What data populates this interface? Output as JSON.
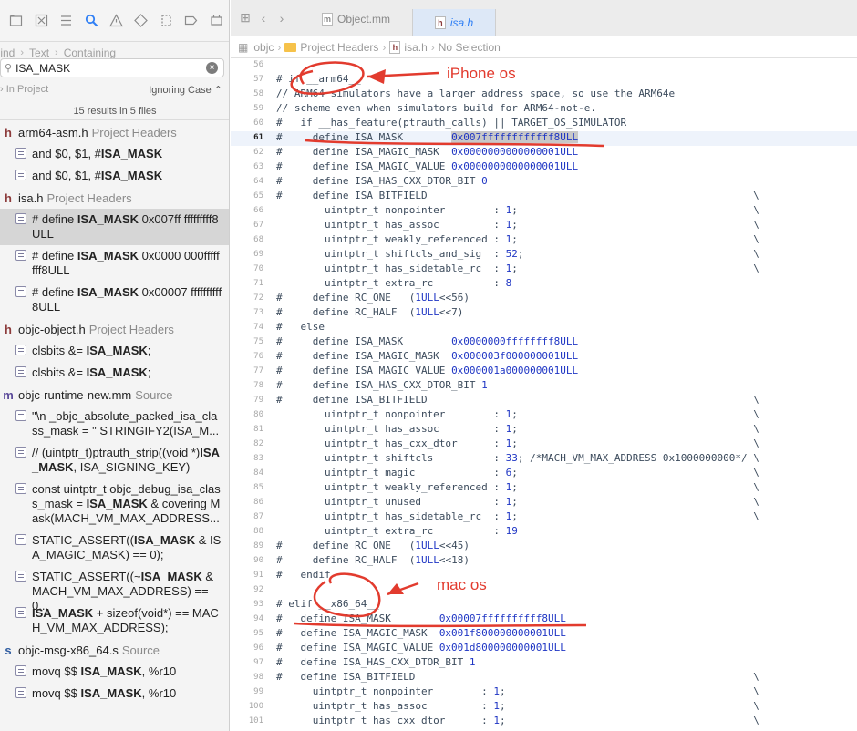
{
  "navigator": {
    "find_path": [
      "Find",
      "Text",
      "Containing"
    ],
    "search_value": "ISA_MASK",
    "scope": "In Project",
    "matching": "Ignoring Case",
    "results_summary": "15 results in 5 files",
    "groups": [
      {
        "type": "h",
        "file": "arm64-asm.h",
        "group": "Project Headers",
        "results": [
          {
            "text": "and  $0, $1, #ISA_MASK",
            "lines": 1
          },
          {
            "text": "and    $0, $1, #ISA_MASK",
            "lines": 1
          }
        ]
      },
      {
        "type": "h",
        "file": "isa.h",
        "group": "Project Headers",
        "results": [
          {
            "text": "#    define ISA_MASK          0x007ff fffffffff8ULL",
            "lines": 2,
            "selected": true
          },
          {
            "text": "#    define ISA_MASK          0x0000 000ffffffff8ULL",
            "lines": 2
          },
          {
            "text": "#   define ISA_MASK          0x00007 ffffffffff8ULL",
            "lines": 2
          }
        ]
      },
      {
        "type": "h",
        "file": "objc-object.h",
        "group": "Project Headers",
        "results": [
          {
            "text": "clsbits &= ISA_MASK;",
            "lines": 1
          },
          {
            "text": "clsbits &= ISA_MASK;",
            "lines": 1
          }
        ]
      },
      {
        "type": "m",
        "file": "objc-runtime-new.mm",
        "group": "Source",
        "results": [
          {
            "text": "\"\\n _objc_absolute_packed_isa_class_mask = \" STRINGIFY2(ISA_M...",
            "lines": 2
          },
          {
            "text": "//     (uintptr_t)ptrauth_strip((void *)ISA_MASK, ISA_SIGNING_KEY)",
            "lines": 2
          },
          {
            "text": "const uintptr_t objc_debug_isa_class_mask  = ISA_MASK & covering Mask(MACH_VM_MAX_ADDRESS...",
            "lines": 3
          },
          {
            "text": "STATIC_ASSERT((ISA_MASK & ISA_MAGIC_MASK) == 0);",
            "lines": 2
          },
          {
            "text": "STATIC_ASSERT((~ISA_MASK & MACH_VM_MAX_ADDRESS) == 0...",
            "lines": 2
          },
          {
            "text": "ISA_MASK + sizeof(void*) == MACH_VM_MAX_ADDRESS);",
            "lines": 2
          }
        ]
      },
      {
        "type": "s",
        "file": "objc-msg-x86_64.s",
        "group": "Source",
        "results": [
          {
            "text": "movq       $$ ISA_MASK, %r10",
            "lines": 1
          },
          {
            "text": "movq       $$ ISA_MASK, %r10",
            "lines": 1
          }
        ]
      }
    ]
  },
  "editor": {
    "tabs": [
      {
        "label": "Object.mm",
        "type": "m",
        "active": false
      },
      {
        "label": "isa.h",
        "type": "h",
        "active": true
      }
    ],
    "jumpbar": [
      "objc",
      "Project Headers",
      "isa.h",
      "No Selection"
    ],
    "current_line": 61,
    "lines": [
      {
        "n": 56,
        "t": ""
      },
      {
        "n": 57,
        "t": "# if __arm64__"
      },
      {
        "n": 58,
        "t": "// ARM64 simulators have a larger address space, so use the ARM64e"
      },
      {
        "n": 59,
        "t": "// scheme even when simulators build for ARM64-not-e."
      },
      {
        "n": 60,
        "t": "#   if __has_feature(ptrauth_calls) || TARGET_OS_SIMULATOR"
      },
      {
        "n": 61,
        "t": "#     define ISA_MASK        0x007ffffffffffff8ULL"
      },
      {
        "n": 62,
        "t": "#     define ISA_MAGIC_MASK  0x0000000000000001ULL"
      },
      {
        "n": 63,
        "t": "#     define ISA_MAGIC_VALUE 0x0000000000000001ULL"
      },
      {
        "n": 64,
        "t": "#     define ISA_HAS_CXX_DTOR_BIT 0"
      },
      {
        "n": 65,
        "t": "#     define ISA_BITFIELD                                                      \\"
      },
      {
        "n": 66,
        "t": "        uintptr_t nonpointer        : 1;                                       \\"
      },
      {
        "n": 67,
        "t": "        uintptr_t has_assoc         : 1;                                       \\"
      },
      {
        "n": 68,
        "t": "        uintptr_t weakly_referenced : 1;                                       \\"
      },
      {
        "n": 69,
        "t": "        uintptr_t shiftcls_and_sig  : 52;                                      \\"
      },
      {
        "n": 70,
        "t": "        uintptr_t has_sidetable_rc  : 1;                                       \\"
      },
      {
        "n": 71,
        "t": "        uintptr_t extra_rc          : 8"
      },
      {
        "n": 72,
        "t": "#     define RC_ONE   (1ULL<<56)"
      },
      {
        "n": 73,
        "t": "#     define RC_HALF  (1ULL<<7)"
      },
      {
        "n": 74,
        "t": "#   else"
      },
      {
        "n": 75,
        "t": "#     define ISA_MASK        0x0000000ffffffff8ULL"
      },
      {
        "n": 76,
        "t": "#     define ISA_MAGIC_MASK  0x000003f000000001ULL"
      },
      {
        "n": 77,
        "t": "#     define ISA_MAGIC_VALUE 0x000001a000000001ULL"
      },
      {
        "n": 78,
        "t": "#     define ISA_HAS_CXX_DTOR_BIT 1"
      },
      {
        "n": 79,
        "t": "#     define ISA_BITFIELD                                                      \\"
      },
      {
        "n": 80,
        "t": "        uintptr_t nonpointer        : 1;                                       \\"
      },
      {
        "n": 81,
        "t": "        uintptr_t has_assoc         : 1;                                       \\"
      },
      {
        "n": 82,
        "t": "        uintptr_t has_cxx_dtor      : 1;                                       \\"
      },
      {
        "n": 83,
        "t": "        uintptr_t shiftcls          : 33; /*MACH_VM_MAX_ADDRESS 0x1000000000*/ \\"
      },
      {
        "n": 84,
        "t": "        uintptr_t magic             : 6;                                       \\"
      },
      {
        "n": 85,
        "t": "        uintptr_t weakly_referenced : 1;                                       \\"
      },
      {
        "n": 86,
        "t": "        uintptr_t unused            : 1;                                       \\"
      },
      {
        "n": 87,
        "t": "        uintptr_t has_sidetable_rc  : 1;                                       \\"
      },
      {
        "n": 88,
        "t": "        uintptr_t extra_rc          : 19"
      },
      {
        "n": 89,
        "t": "#     define RC_ONE   (1ULL<<45)"
      },
      {
        "n": 90,
        "t": "#     define RC_HALF  (1ULL<<18)"
      },
      {
        "n": 91,
        "t": "#   endif"
      },
      {
        "n": 92,
        "t": ""
      },
      {
        "n": 93,
        "t": "# elif __x86_64__"
      },
      {
        "n": 94,
        "t": "#   define ISA_MASK        0x00007ffffffffff8ULL"
      },
      {
        "n": 95,
        "t": "#   define ISA_MAGIC_MASK  0x001f800000000001ULL"
      },
      {
        "n": 96,
        "t": "#   define ISA_MAGIC_VALUE 0x001d800000000001ULL"
      },
      {
        "n": 97,
        "t": "#   define ISA_HAS_CXX_DTOR_BIT 1"
      },
      {
        "n": 98,
        "t": "#   define ISA_BITFIELD                                                        \\"
      },
      {
        "n": 99,
        "t": "      uintptr_t nonpointer        : 1;                                         \\"
      },
      {
        "n": 100,
        "t": "      uintptr_t has_assoc         : 1;                                         \\"
      },
      {
        "n": 101,
        "t": "      uintptr_t has_cxx_dtor      : 1;                                         \\"
      }
    ]
  },
  "annotations": {
    "iphone_label": "iPhone os",
    "mac_label": "mac os",
    "color": "#e23b2e"
  }
}
